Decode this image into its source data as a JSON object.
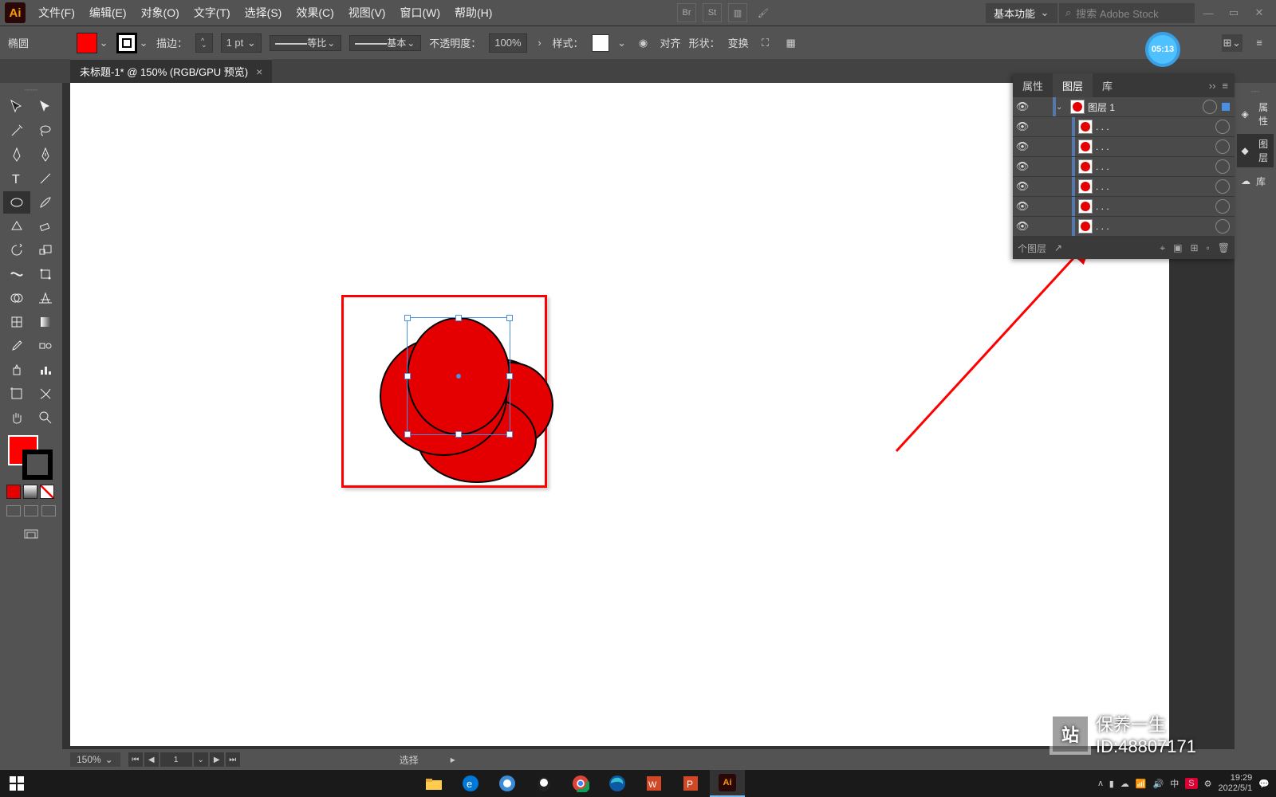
{
  "menubar": {
    "logo": "Ai",
    "items": [
      "文件(F)",
      "编辑(E)",
      "对象(O)",
      "文字(T)",
      "选择(S)",
      "效果(C)",
      "视图(V)",
      "窗口(W)",
      "帮助(H)"
    ],
    "badge1": "Br",
    "badge2": "St",
    "workspace": "基本功能",
    "search_placeholder": "搜索 Adobe Stock"
  },
  "optbar": {
    "tool_name": "椭圆",
    "stroke_label": "描边：",
    "stroke_width": "1 pt",
    "profile_label": "等比",
    "brush_label": "基本",
    "opacity_label": "不透明度：",
    "opacity_value": "100%",
    "style_label": "样式：",
    "align_label": "对齐",
    "shape_label": "形状：",
    "transform_label": "变换"
  },
  "timer": "05:13",
  "doctab": {
    "title": "未标题-1* @ 150% (RGB/GPU 预览)"
  },
  "layers": {
    "tab_props": "属性",
    "tab_layers": "图层",
    "tab_lib": "库",
    "layer_name": "图层 1",
    "sublayer_placeholder": ". . .",
    "footer_text": "个图层"
  },
  "rightcol": {
    "props": "属性",
    "layers": "图层",
    "lib": "库"
  },
  "statusbar": {
    "zoom": "150%",
    "artboard": "1",
    "mode": "选择"
  },
  "taskbar": {
    "time": "19:29",
    "date": "2022/5/1",
    "ime": "中"
  },
  "watermark": {
    "brand": "保养一生",
    "id": "ID:48807171",
    "icon": "站"
  }
}
